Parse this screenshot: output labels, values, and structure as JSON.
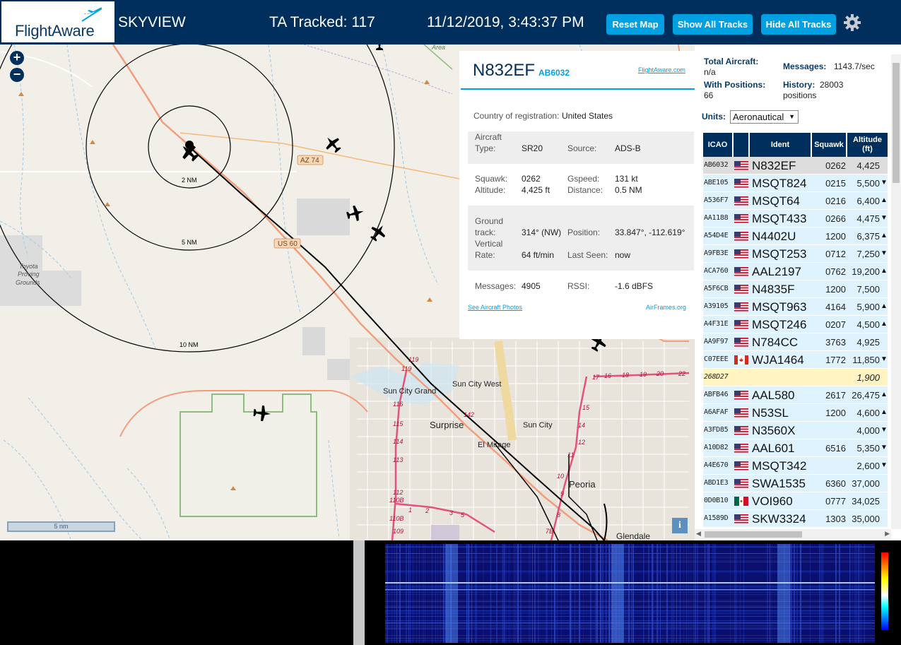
{
  "header": {
    "logo_text": "FlightAware",
    "app_title": "SKYVIEW",
    "ta_tracked": "TA Tracked: 117",
    "datetime": "11/12/2019, 3:43:37 PM",
    "buttons": {
      "reset": "Reset Map",
      "show_all": "Show All Tracks",
      "hide_all": "Hide All Tracks"
    },
    "colors": {
      "bar": "#002f5d",
      "button": "#00a0e2"
    }
  },
  "map": {
    "zoom_in": "+",
    "zoom_out": "−",
    "scale": "5 nm",
    "info": "i",
    "range_rings": [
      "2 NM",
      "5 NM",
      "10 NM"
    ],
    "labels": {
      "area": "Area",
      "az74": "AZ 74",
      "us60": "US 60",
      "toyota": [
        "Toyota",
        "Proving",
        "Grounds"
      ],
      "sun_city_grand": "Sun City Grand",
      "sun_city_west": "Sun City West",
      "surprise": "Surprise",
      "sun_city": "Sun City",
      "el_mirage": "El Mirage",
      "peoria": "Peoria",
      "glendale": "Glendale"
    },
    "exit_numbers": [
      "119",
      "119",
      "116",
      "115",
      "114",
      "113",
      "112",
      "110B",
      "110B",
      "109",
      "142",
      "17",
      "16",
      "18",
      "19",
      "20",
      "22",
      "15",
      "14",
      "12",
      "11",
      "10",
      "9",
      "8",
      "7B",
      "1",
      "2",
      "3",
      "5"
    ]
  },
  "selected": {
    "ident": "N832EF",
    "icao": "AB6032",
    "fa_link": "FlightAware.com",
    "country_label": "Country of registration:",
    "country": "United States",
    "aircraft_type_label": "Aircraft Type:",
    "aircraft_type_label_1": "Aircraft",
    "aircraft_type_label_2": "Type:",
    "aircraft_type": "SR20",
    "source_label": "Source:",
    "source": "ADS-B",
    "squawk_label": "Squawk:",
    "squawk": "0262",
    "altitude_label": "Altitude:",
    "altitude": "4,425 ft",
    "gspeed_label": "Gspeed:",
    "gspeed": "131 kt",
    "distance_label": "Distance:",
    "distance": "0.5 NM",
    "ground_track_label_1": "Ground",
    "ground_track_label_2": "track:",
    "ground_track": "314° (NW)",
    "position_label": "Position:",
    "position": "33.847°, -112.619°",
    "vertical_rate_label_1": "Vertical",
    "vertical_rate_label_2": "Rate:",
    "vertical_rate": "64 ft/min",
    "last_seen_label": "Last Seen:",
    "last_seen": "now",
    "messages_label": "Messages:",
    "messages": "4905",
    "rssi_label": "RSSI:",
    "rssi": "-1.6 dBFS",
    "photos_link": "See Aircraft Photos",
    "airframes_link": "AirFrames.org"
  },
  "stats": {
    "total_aircraft_label": "Total Aircraft:",
    "total_aircraft": "n/a",
    "messages_label": "Messages:",
    "messages": "1143.7/sec",
    "with_positions_label": "With Positions:",
    "with_positions": "66",
    "history_label": "History:",
    "history": "28003",
    "history_unit": "positions",
    "units_label": "Units:",
    "units_value": "Aeronautical"
  },
  "table": {
    "headers": {
      "icao": "ICAO",
      "ident": "Ident",
      "squawk": "Squawk",
      "altitude_1": "Altitude",
      "altitude_2": "(ft)"
    },
    "rows": [
      {
        "icao": "AB6032",
        "flag": "us",
        "ident": "N832EF",
        "squawk": "0262",
        "altitude": "4,425",
        "trend": "",
        "selected": true
      },
      {
        "icao": "ABE105",
        "flag": "us",
        "ident": "MSQT824",
        "squawk": "0215",
        "altitude": "5,500",
        "trend": "▼"
      },
      {
        "icao": "A536F7",
        "flag": "us",
        "ident": "MSQT64",
        "squawk": "0216",
        "altitude": "6,400",
        "trend": "▲"
      },
      {
        "icao": "AA1188",
        "flag": "us",
        "ident": "MSQT433",
        "squawk": "0266",
        "altitude": "4,475",
        "trend": "▼"
      },
      {
        "icao": "A54D4E",
        "flag": "us",
        "ident": "N4402U",
        "squawk": "1200",
        "altitude": "6,375",
        "trend": "▲"
      },
      {
        "icao": "A9FB3E",
        "flag": "us",
        "ident": "MSQT253",
        "squawk": "0712",
        "altitude": "7,250",
        "trend": "▼"
      },
      {
        "icao": "ACA760",
        "flag": "us",
        "ident": "AAL2197",
        "squawk": "0762",
        "altitude": "19,200",
        "trend": "▲"
      },
      {
        "icao": "A5F6CB",
        "flag": "us",
        "ident": "N4835F",
        "squawk": "1200",
        "altitude": "7,500",
        "trend": ""
      },
      {
        "icao": "A39105",
        "flag": "us",
        "ident": "MSQT963",
        "squawk": "4164",
        "altitude": "5,900",
        "trend": "▲"
      },
      {
        "icao": "A4F31E",
        "flag": "us",
        "ident": "MSQT246",
        "squawk": "0207",
        "altitude": "4,500",
        "trend": "▲"
      },
      {
        "icao": "AA9F97",
        "flag": "us",
        "ident": "N784CC",
        "squawk": "3763",
        "altitude": "4,925",
        "trend": ""
      },
      {
        "icao": "C07EEE",
        "flag": "ca",
        "ident": "WJA1464",
        "squawk": "1772",
        "altitude": "11,850",
        "trend": "▼"
      },
      {
        "icao": "268D27",
        "flag": "",
        "ident": "",
        "squawk": "",
        "altitude": "1,900",
        "trend": "",
        "mlat": true
      },
      {
        "icao": "ABFB46",
        "flag": "us",
        "ident": "AAL580",
        "squawk": "2617",
        "altitude": "26,475",
        "trend": "▲"
      },
      {
        "icao": "A6AFAF",
        "flag": "us",
        "ident": "N53SL",
        "squawk": "1200",
        "altitude": "4,600",
        "trend": "▲"
      },
      {
        "icao": "A3FD85",
        "flag": "us",
        "ident": "N3560X",
        "squawk": "",
        "altitude": "4,000",
        "trend": "▼"
      },
      {
        "icao": "A10D82",
        "flag": "us",
        "ident": "AAL601",
        "squawk": "6516",
        "altitude": "5,350",
        "trend": "▼"
      },
      {
        "icao": "A4E670",
        "flag": "us",
        "ident": "MSQT342",
        "squawk": "",
        "altitude": "2,600",
        "trend": "▼"
      },
      {
        "icao": "ABD1E3",
        "flag": "us",
        "ident": "SWA1535",
        "squawk": "6360",
        "altitude": "37,000",
        "trend": ""
      },
      {
        "icao": "0D0B10",
        "flag": "mx",
        "ident": "VOI960",
        "squawk": "0777",
        "altitude": "34,025",
        "trend": ""
      },
      {
        "icao": "A1589D",
        "flag": "us",
        "ident": "SKW3324",
        "squawk": "1303",
        "altitude": "35,000",
        "trend": ""
      }
    ]
  }
}
